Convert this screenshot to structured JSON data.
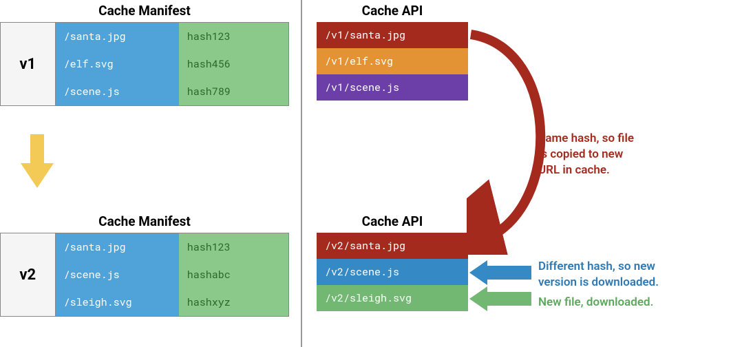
{
  "manifest_heading": "Cache Manifest",
  "cache_heading": "Cache API",
  "v1_label": "v1",
  "v2_label": "v2",
  "manifest_v1": {
    "files": [
      "/santa.jpg",
      "/elf.svg",
      "/scene.js"
    ],
    "hashes": [
      "hash123",
      "hash456",
      "hash789"
    ]
  },
  "manifest_v2": {
    "files": [
      "/santa.jpg",
      "/scene.js",
      "/sleigh.svg"
    ],
    "hashes": [
      "hash123",
      "hashabc",
      "hashxyz"
    ]
  },
  "cache_v1": {
    "rows": [
      {
        "label": "/v1/santa.jpg",
        "color": "c-red"
      },
      {
        "label": "/v1/elf.svg",
        "color": "c-orange"
      },
      {
        "label": "/v1/scene.js",
        "color": "c-purple"
      }
    ]
  },
  "cache_v2": {
    "rows": [
      {
        "label": "/v2/santa.jpg",
        "color": "c-red"
      },
      {
        "label": "/v2/scene.js",
        "color": "c-blue"
      },
      {
        "label": "/v2/sleigh.svg",
        "color": "c-green"
      }
    ]
  },
  "note_same_hash": "Same hash, so file\nis copied to new\nURL in cache.",
  "note_diff_hash": "Different hash, so new\nversion is downloaded.",
  "note_new_file": "New file, downloaded."
}
